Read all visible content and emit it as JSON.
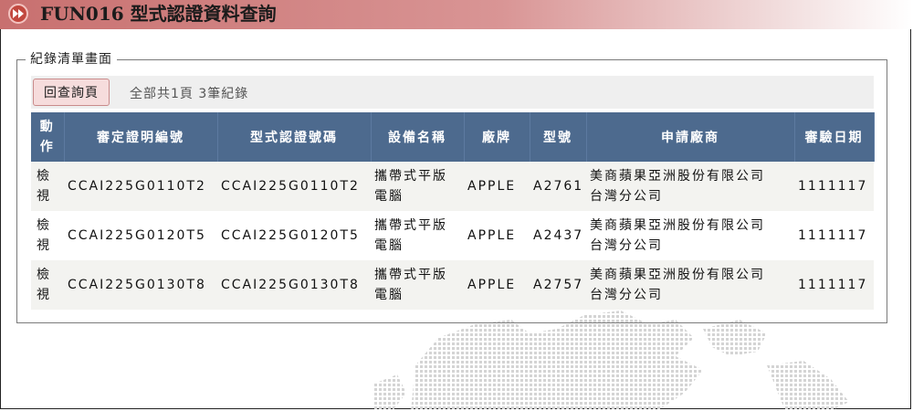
{
  "header": {
    "title": "FUN016 型式認證資料查詢",
    "icon": "fast-forward-icon"
  },
  "fieldset": {
    "legend": "紀錄清單畫面"
  },
  "toolbar": {
    "back_label": "回查詢頁",
    "page_info": "全部共1頁  3筆紀錄"
  },
  "table": {
    "columns": [
      "動作",
      "審定證明編號",
      "型式認證號碼",
      "設備名稱",
      "廠牌",
      "型號",
      "申請廠商",
      "審驗日期"
    ],
    "rows": [
      {
        "action": [
          "檢",
          "視"
        ],
        "cert_no": "CCAI225G0110T2",
        "type_no": "CCAI225G0110T2",
        "device": [
          "攜帶式平版",
          "電腦"
        ],
        "brand": "APPLE",
        "model": "A2761",
        "applicant": [
          "美商蘋果亞洲股份有限公司",
          "台灣分公司"
        ],
        "date": "1111117"
      },
      {
        "action": [
          "檢",
          "視"
        ],
        "cert_no": "CCAI225G0120T5",
        "type_no": "CCAI225G0120T5",
        "device": [
          "攜帶式平版",
          "電腦"
        ],
        "brand": "APPLE",
        "model": "A2437",
        "applicant": [
          "美商蘋果亞洲股份有限公司",
          "台灣分公司"
        ],
        "date": "1111117"
      },
      {
        "action": [
          "檢",
          "視"
        ],
        "cert_no": "CCAI225G0130T8",
        "type_no": "CCAI225G0130T8",
        "device": [
          "攜帶式平版",
          "電腦"
        ],
        "brand": "APPLE",
        "model": "A2757",
        "applicant": [
          "美商蘋果亞洲股份有限公司",
          "台灣分公司"
        ],
        "date": "1111117"
      }
    ]
  },
  "colors": {
    "header_accent": "#c8706f",
    "table_header": "#4d6a8e",
    "link": "#2b5c9a",
    "button_bg": "#f6dcdc"
  }
}
